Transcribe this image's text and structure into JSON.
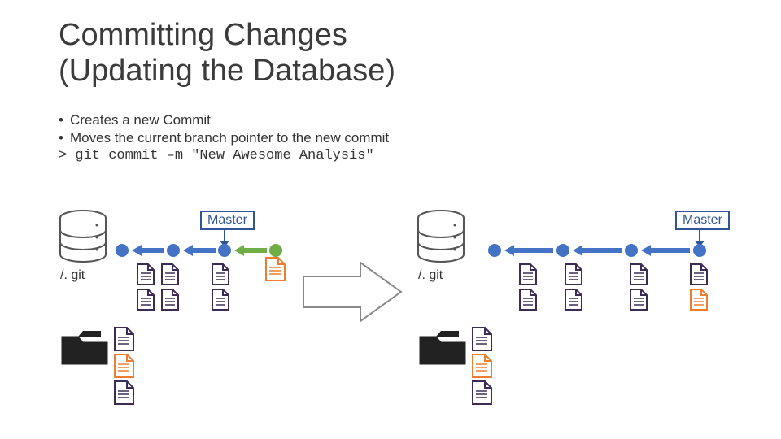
{
  "title_line1": "Committing Changes",
  "title_line2": "(Updating the Database)",
  "bullets": {
    "b1": "Creates a new Commit",
    "b2": "Moves the current branch pointer to the new commit",
    "cmd": "> git commit –m \"New Awesome Analysis\""
  },
  "labels": {
    "master": "Master",
    "gitdir": "/. git"
  },
  "colors": {
    "blue": "#4472C4",
    "darkblue": "#2F5597",
    "green": "#70AD47",
    "orange": "#ED7D31",
    "purple": "#3C2C55"
  }
}
